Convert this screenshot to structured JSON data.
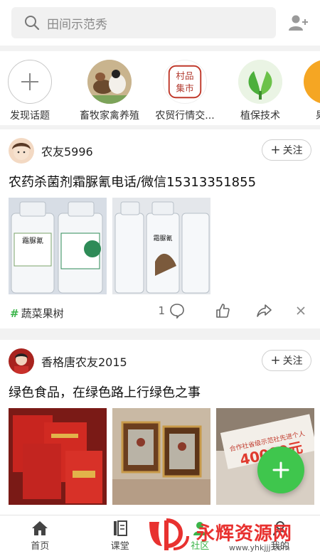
{
  "search": {
    "placeholder": "田间示范秀"
  },
  "topics": [
    {
      "label": "发现话题",
      "icon": "plus-icon"
    },
    {
      "label": "畜牧家禽养殖",
      "icon": "livestock-image"
    },
    {
      "label": "农贸行情交...",
      "icon": "market-logo",
      "logo_text": "村品集市"
    },
    {
      "label": "植保技术",
      "icon": "leaf-image"
    },
    {
      "label": "果蔬",
      "icon": "fruit-image"
    }
  ],
  "posts": [
    {
      "username": "农友5996",
      "follow_label": "关注",
      "title": "农药杀菌剂霜脲氰电话/微信15313351855",
      "bottle_label": "霜脲氰",
      "topic": "蔬菜果树",
      "comment_count": "1"
    },
    {
      "username": "香格唐农友2015",
      "follow_label": "关注",
      "title": "绿色食品，在绿色路上行绿色之事",
      "banner_text": "合作社省级示范社先进个人",
      "banner_amount": "40000元"
    }
  ],
  "nav": [
    {
      "label": "首页",
      "icon": "home-icon"
    },
    {
      "label": "课堂",
      "icon": "class-icon"
    },
    {
      "label": "社区",
      "icon": "community-icon"
    },
    {
      "label": "我的",
      "icon": "profile-icon"
    }
  ],
  "watermark": {
    "text": "永辉资源网",
    "url": "www.yhkjjj.com"
  },
  "colors": {
    "accent": "#3bb54a",
    "fab": "#3fc64d",
    "watermark": "#e8312f"
  }
}
